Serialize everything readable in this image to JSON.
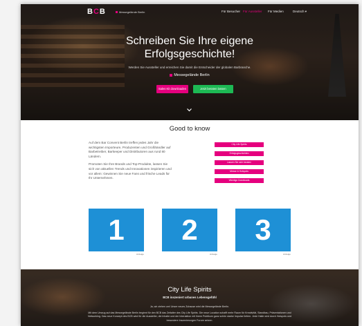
{
  "nav": {
    "logo_left": "B",
    "logo_accent": "C",
    "logo_right": "B",
    "logo_sub": "Messegelände Berlin",
    "links": [
      "Für Besucher",
      "Für Aussteller",
      "Für Medien",
      "Deutsch ▾"
    ]
  },
  "hero": {
    "title_line1": "Schreiben Sie Ihre eigene",
    "title_line2": "Erfolgsgeschichte!",
    "subtitle": "Werden Sie Aussteller und erreichen Sie damit die Entscheider der globalen Barbranche.",
    "location": "Messegelände Berlin",
    "btn_download": "Sales Kit downloaden",
    "btn_register": "Jetzt beraten lassen"
  },
  "good_to_know": {
    "title": "Good to know",
    "para1": "Auf dem Bar Convent Berlin treffen jedes Jahr die wichtigsten Importeure, Produzenten und Großhändler auf Barbetreiber, Barkeeper und Distributoren aus rund 80 Ländern.",
    "para2": "Promoten Sie Ihre Brands und Top-Produkte, lassen Sie sich von aktuellen Trends und Innovationen inspirieren und vor allem: Gewinnen Sie neue Fans und frische Leads für Ihr Unternehmen.",
    "buttons": [
      "City Life Spirits",
      "Erfolgsgeschichten",
      "Lassen Sie sich beraten",
      "Messe & Hotspots",
      "Wichtige Downloads"
    ]
  },
  "numbers": [
    {
      "value": "1",
      "caption": "Anzeige"
    },
    {
      "value": "2",
      "caption": "Anzeige"
    },
    {
      "value": "3",
      "caption": "Anzeige"
    }
  ],
  "city": {
    "title": "City Life Spirits",
    "subtitle": "BCB inszeniert urbanes Lebensgefühl",
    "para1": "Ja, wir ziehen um! Unser neues Zuhause wird die Messegelände Berlin.",
    "para2": "Mit dem Umzug auf das Messegelände Berlin beginnt für den BCB das Zeitalter des City Life Spirits. Die neue Location schafft mehr Raum für Kreativität, Standbau, Präsentationen und Networking. Das neue Konzept des BCB wird für die Aussteller, die Inhalte und der Interaktion mit ihrem Publikum ganz schön starke Impulse liefern. Jede Halle wird durch Hotspots und besondere Inszenierungen Furore setzen."
  },
  "colors": {
    "accent_pink": "#e5007e",
    "accent_green": "#1db954",
    "number_box_blue": "#1e90d6"
  }
}
